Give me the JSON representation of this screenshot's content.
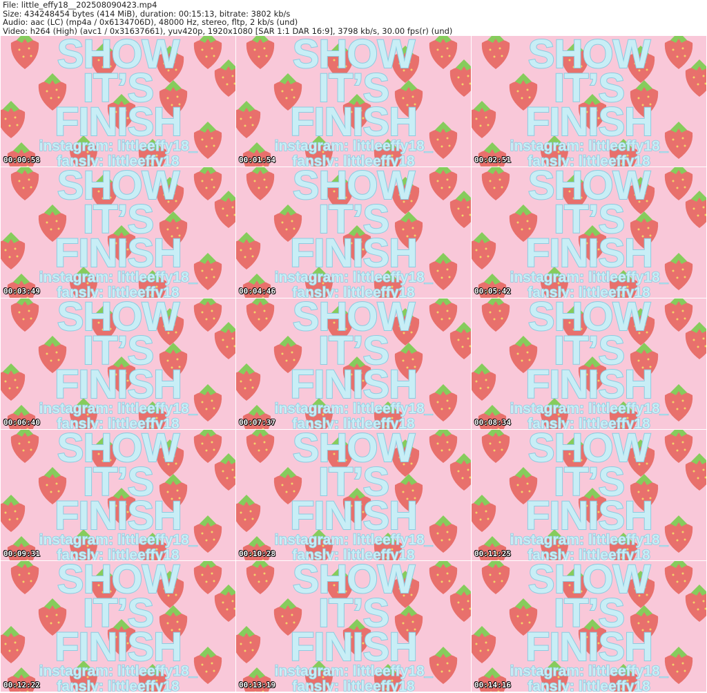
{
  "header": {
    "file": "File: little_effy18__202508090423.mp4",
    "size": "Size: 434248454 bytes (414 MiB), duration: 00:15:13, bitrate: 3802 kb/s",
    "audio": "Audio: aac (LC) (mp4a / 0x6134706D), 48000 Hz, stereo, fltp, 2 kb/s (und)",
    "video": "Video: h264 (High) (avc1 / 0x31637661), yuv420p, 1920x1080 [SAR 1:1 DAR 16:9], 3798 kb/s, 30.00 fps(r) (und)"
  },
  "frame_text": {
    "line1": "SHOW",
    "line2": "IT’S",
    "line3": "FINISH",
    "line4": "instagram:  littleeffy18_",
    "line5": "fansly: littleeffy18"
  },
  "colors": {
    "background": "#f9c8d9",
    "text": "#c8eef6",
    "stroke": "#8ccbe0",
    "strawberry": "#e8706c",
    "leaf": "#86cc5c",
    "seed": "#f3d36a"
  },
  "timestamps": [
    "00:00:58",
    "00:01:54",
    "00:02:51",
    "00:03:49",
    "00:04:46",
    "00:05:42",
    "00:06:40",
    "00:07:37",
    "00:08:34",
    "00:09:31",
    "00:10:28",
    "00:11:25",
    "00:12:22",
    "00:13:19",
    "00:14:16"
  ]
}
